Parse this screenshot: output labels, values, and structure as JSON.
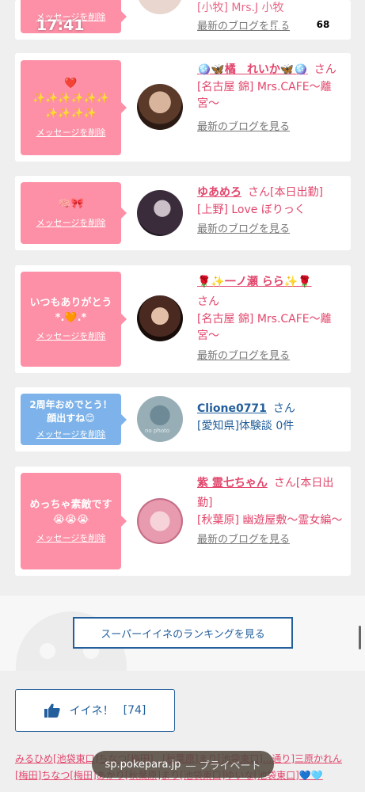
{
  "status": {
    "time": "17:41",
    "battery": "68"
  },
  "top_card": {
    "delete_label": "メッセージを削除",
    "shop": "[小牧] Mrs.J 小牧",
    "blog": "最新のブログを見る"
  },
  "cards": [
    {
      "bubble_color": "pink",
      "message": "❤️\n✨✨✨✨✨✨\n✨✨✨✨",
      "delete_label": "メッセージを削除",
      "name": "🪩🦋橘　れいか🦋🪩",
      "san": "さん",
      "shop": "[名古屋 錦] Mrs.CAFE〜離宮〜",
      "blog": "最新のブログを見る"
    },
    {
      "bubble_color": "pink",
      "message": "🧠🎀",
      "delete_label": "メッセージを削除",
      "name": "ゆあめろ",
      "san": "さん[本日出勤]",
      "shop": "[上野] Love ぼりっく",
      "blog": "最新のブログを見る"
    },
    {
      "bubble_color": "pink",
      "message": "いつもありがとう\n*.🧡.*",
      "delete_label": "メッセージを削除",
      "name": "🌹✨一ノ瀬 らら✨🌹",
      "san": "さん",
      "shop": "[名古屋 錦] Mrs.CAFE〜離宮〜",
      "blog": "最新のブログを見る"
    },
    {
      "bubble_color": "blue",
      "message": "2周年おめでとう！顔出すね😊",
      "delete_label": "メッセージを削除",
      "name": "Clione0771",
      "san": "さん",
      "shop": "[愛知県]体験談 0件",
      "blog": ""
    },
    {
      "bubble_color": "pink",
      "message": "めっちゃ素敵です😭😭😭",
      "delete_label": "メッセージを削除",
      "name": "紫 霊七ちゃん",
      "san": "さん[本日出勤]",
      "shop": "[秋葉原] 幽遊屋敷〜霊女編〜",
      "blog": "最新のブログを見る"
    }
  ],
  "ranking_button": "スーパーイイネのランキングを見る",
  "iine": {
    "label": "イイネ！",
    "count": "[74]"
  },
  "names_list": "みるひめ[池袋東口]ちなつ[梅田]...[秋葉原]まり[池袋東口]...通り]三原かれん[梅田]ちなつ[梅田]あかり[秋葉原]まり[池袋東口]ゆいな[池袋東口]💙🩵",
  "url_bar": {
    "domain": "sp.pokepara.jp",
    "mode": "— プライベート"
  }
}
